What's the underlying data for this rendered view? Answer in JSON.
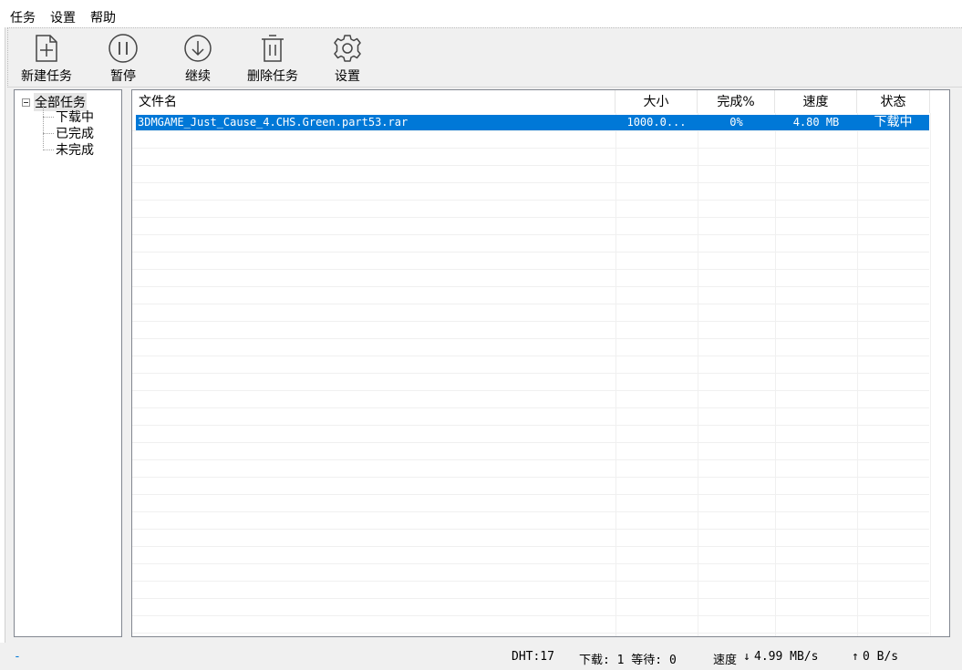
{
  "menu": {
    "items": [
      "任务",
      "设置",
      "帮助"
    ]
  },
  "toolbar": {
    "buttons": [
      {
        "label": "新建任务",
        "icon": "new-task-icon"
      },
      {
        "label": "暂停",
        "icon": "pause-icon"
      },
      {
        "label": "继续",
        "icon": "resume-icon"
      },
      {
        "label": "删除任务",
        "icon": "trash-icon"
      },
      {
        "label": "设置",
        "icon": "gear-icon"
      }
    ]
  },
  "tree": {
    "root": "全部任务",
    "children": [
      "下载中",
      "已完成",
      "未完成"
    ]
  },
  "list": {
    "columns": [
      "文件名",
      "大小",
      "完成%",
      "速度",
      "状态"
    ],
    "rows": [
      {
        "filename": "3DMGAME_Just_Cause_4.CHS.Green.part53.rar",
        "size": "1000.0...",
        "progress": "0%",
        "speed": "4.80 MB",
        "status": "下载中",
        "selected": true
      }
    ]
  },
  "statusbar": {
    "left_mark": "-",
    "dht": "DHT:17",
    "queue": "下载: 1 等待: 0",
    "speed_label": "速度",
    "down_speed": "4.99 MB/s",
    "up_speed": "0 B/s"
  },
  "colors": {
    "selection": "#0078d7",
    "window_bg": "#f0f0f0",
    "border": "#828790",
    "left_mark": "#0078d7"
  }
}
